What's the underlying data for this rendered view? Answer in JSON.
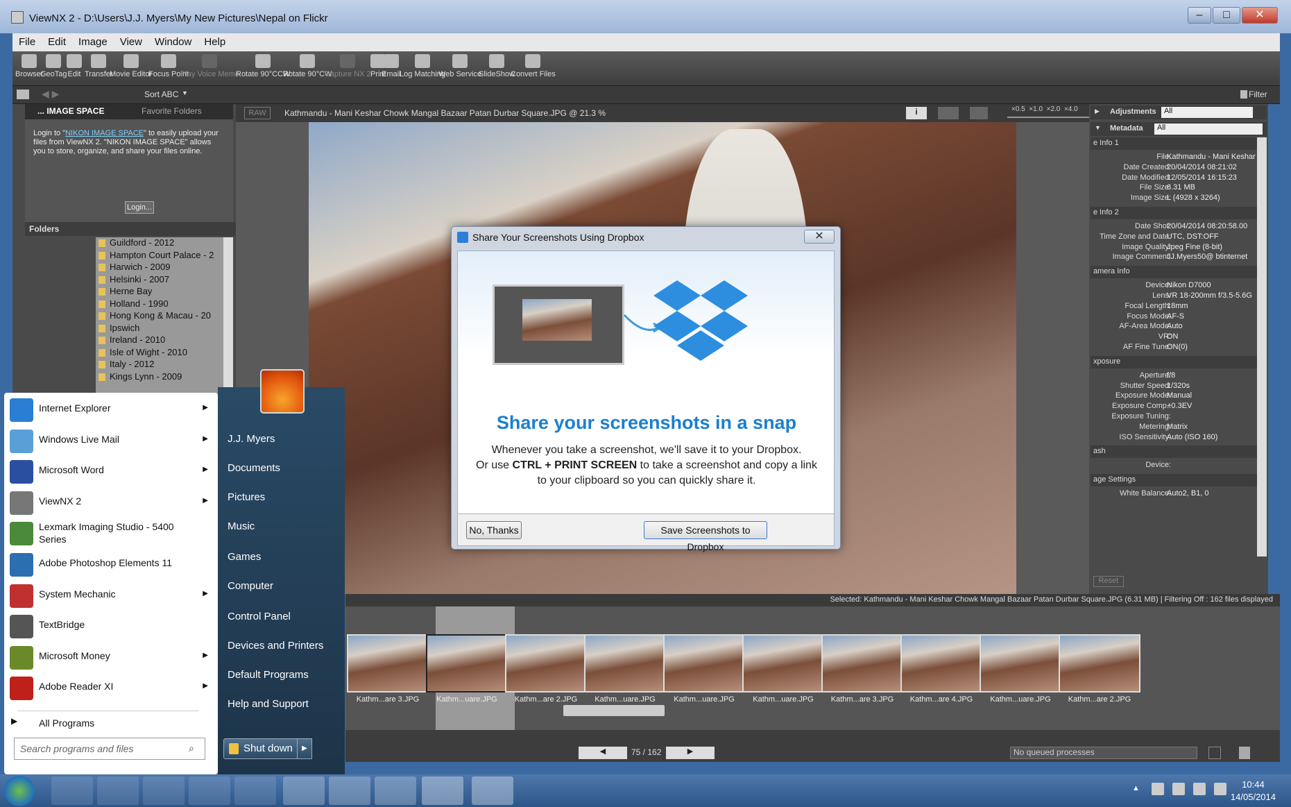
{
  "window": {
    "title": "ViewNX 2 - D:\\Users\\J.J. Myers\\My New Pictures\\Nepal on Flickr"
  },
  "menu": [
    "File",
    "Edit",
    "Image",
    "View",
    "Window",
    "Help"
  ],
  "toolbar": [
    "Browser",
    "GeoTag",
    "Edit",
    "Transfer",
    "Movie Editor",
    "Focus Point",
    "Play Voice Memo",
    "Rotate 90°CCW",
    "Rotate 90°CW",
    "Capture NX 2",
    "Print",
    "Email",
    "Log Matching",
    "Web Service",
    "SlideShow",
    "Convert Files"
  ],
  "subbar": {
    "sort": "Sort ABC",
    "filter": "Filter"
  },
  "left": {
    "tabs": [
      "... IMAGE SPACE",
      "Favorite Folders"
    ],
    "nikon_pre": "Login to \"",
    "nikon_link": "NIKON IMAGE SPACE",
    "nikon_post": "\" to easily upload your files from ViewNX 2. \"NIKON IMAGE SPACE\" allows you to store, organize, and share your files online.",
    "login": "Login...",
    "folders_header": "Folders",
    "folders": [
      "Guildford - 2012",
      "Hampton Court Palace - 2",
      "Harwich - 2009",
      "Helsinki - 2007",
      "Herne Bay",
      "Holland - 1990",
      "Hong Kong & Macau - 20",
      "Ipswich",
      "Ireland - 2010",
      "Isle of Wight - 2010",
      "Italy - 2012",
      "Kings Lynn - 2009"
    ]
  },
  "viewer": {
    "raw": "RAW",
    "filename": "Kathmandu - Mani Keshar Chowk Mangal Bazaar Patan Durbar Square.JPG @ 21.3 %",
    "zoom": [
      "×0.5",
      "×1.0",
      "×2.0",
      "×4.0"
    ]
  },
  "right": {
    "adjustments": "Adjustments",
    "adj_val": "All",
    "metadata": "Metadata",
    "meta_val": "All",
    "sections": [
      {
        "title": "e Info 1",
        "rows": [
          [
            "File:",
            "Kathmandu - Mani Keshar C"
          ],
          [
            "Date Created:",
            "20/04/2014 08:21:02"
          ],
          [
            "Date Modified:",
            "12/05/2014 16:15:23"
          ],
          [
            "File Size:",
            "6.31 MB"
          ],
          [
            "Image Size:",
            "L (4928 x 3264)"
          ]
        ]
      },
      {
        "title": "e Info 2",
        "rows": [
          [
            "Date Shot:",
            "20/04/2014 08:20:58.00"
          ],
          [
            "Time Zone and Date:",
            "UTC, DST:OFF"
          ],
          [
            "Image Quality:",
            "Jpeg Fine (8-bit)"
          ],
          [
            "Image Comment:",
            "JJ.Myers50@      btinternet"
          ]
        ]
      },
      {
        "title": "amera Info",
        "rows": [
          [
            "Device:",
            "Nikon D7000"
          ],
          [
            "Lens:",
            "VR 18-200mm f/3.5-5.6G"
          ],
          [
            "Focal Length:",
            "18mm"
          ],
          [
            "Focus Mode:",
            "AF-S"
          ],
          [
            "AF-Area Mode:",
            "Auto"
          ],
          [
            "VR:",
            "ON"
          ],
          [
            "AF Fine Tune:",
            "ON(0)"
          ]
        ]
      },
      {
        "title": "xposure",
        "rows": [
          [
            "Aperture:",
            "f/8"
          ],
          [
            "Shutter Speed:",
            "1/320s"
          ],
          [
            "Exposure Mode:",
            "Manual"
          ],
          [
            "Exposure Comp.:",
            "+0.3EV"
          ],
          [
            "Exposure Tuning:",
            ""
          ],
          [
            "Metering:",
            "Matrix"
          ],
          [
            "ISO Sensitivity:",
            "Auto (ISO 160)"
          ]
        ]
      },
      {
        "title": "ash",
        "rows": [
          [
            "Device:",
            ""
          ]
        ]
      },
      {
        "title": "age Settings",
        "rows": [
          [
            "White Balance:",
            "Auto2, B1, 0"
          ]
        ]
      }
    ],
    "reset": "Reset"
  },
  "status": "Selected: Kathmandu - Mani Keshar Chowk Mangal Bazaar Patan Durbar Square.JPG (6.31 MB) | Filtering Off : 162 files displayed",
  "thumbs": [
    "Kathm...are 3.JPG",
    "Kathm...uare.JPG",
    "Kathm...are 2.JPG",
    "Kathm...uare.JPG",
    "Kathm...uare.JPG",
    "Kathm...uare.JPG",
    "Kathm...are 3.JPG",
    "Kathm...are 4.JPG",
    "Kathm...uare.JPG",
    "Kathm...are 2.JPG"
  ],
  "nav": {
    "counter": "75 / 162",
    "queue": "No queued processes"
  },
  "dialog": {
    "title": "Share Your Screenshots Using Dropbox",
    "heading": "Share your screenshots in a snap",
    "line1": "Whenever you take a screenshot, we'll save it to your Dropbox.",
    "line2_pre": "Or use ",
    "line2_key": "CTRL + PRINT SCREEN",
    "line2_post": " to take a screenshot and copy a link to your clipboard so you can quickly share it.",
    "no": "No, Thanks",
    "yes": "Save Screenshots to Dropbox"
  },
  "startmenu": {
    "programs": [
      {
        "label": "Internet Explorer",
        "arrow": true,
        "color": "#2a7fd4"
      },
      {
        "label": "Windows Live Mail",
        "arrow": true,
        "color": "#5aa0d8"
      },
      {
        "label": "Microsoft Word",
        "arrow": true,
        "color": "#2b4fa0"
      },
      {
        "label": "ViewNX 2",
        "arrow": true,
        "color": "#777"
      },
      {
        "label": "Lexmark Imaging Studio - 5400 Series",
        "arrow": false,
        "color": "#4a8a3a"
      },
      {
        "label": "Adobe Photoshop Elements 11",
        "arrow": false,
        "color": "#2b6fb0"
      },
      {
        "label": "System Mechanic",
        "arrow": true,
        "color": "#c03030"
      },
      {
        "label": "TextBridge",
        "arrow": false,
        "color": "#555"
      },
      {
        "label": "Microsoft Money",
        "arrow": true,
        "color": "#6a8a2a"
      },
      {
        "label": "Adobe Reader XI",
        "arrow": true,
        "color": "#c0201a"
      }
    ],
    "all_programs": "All Programs",
    "search_placeholder": "Search programs and files",
    "right": [
      "J.J. Myers",
      "Documents",
      "Pictures",
      "Music",
      "Games",
      "Computer",
      "Control Panel",
      "Devices and Printers",
      "Default Programs",
      "Help and Support"
    ],
    "shutdown": "Shut down"
  },
  "clock": {
    "time": "10:44",
    "date": "14/05/2014"
  }
}
